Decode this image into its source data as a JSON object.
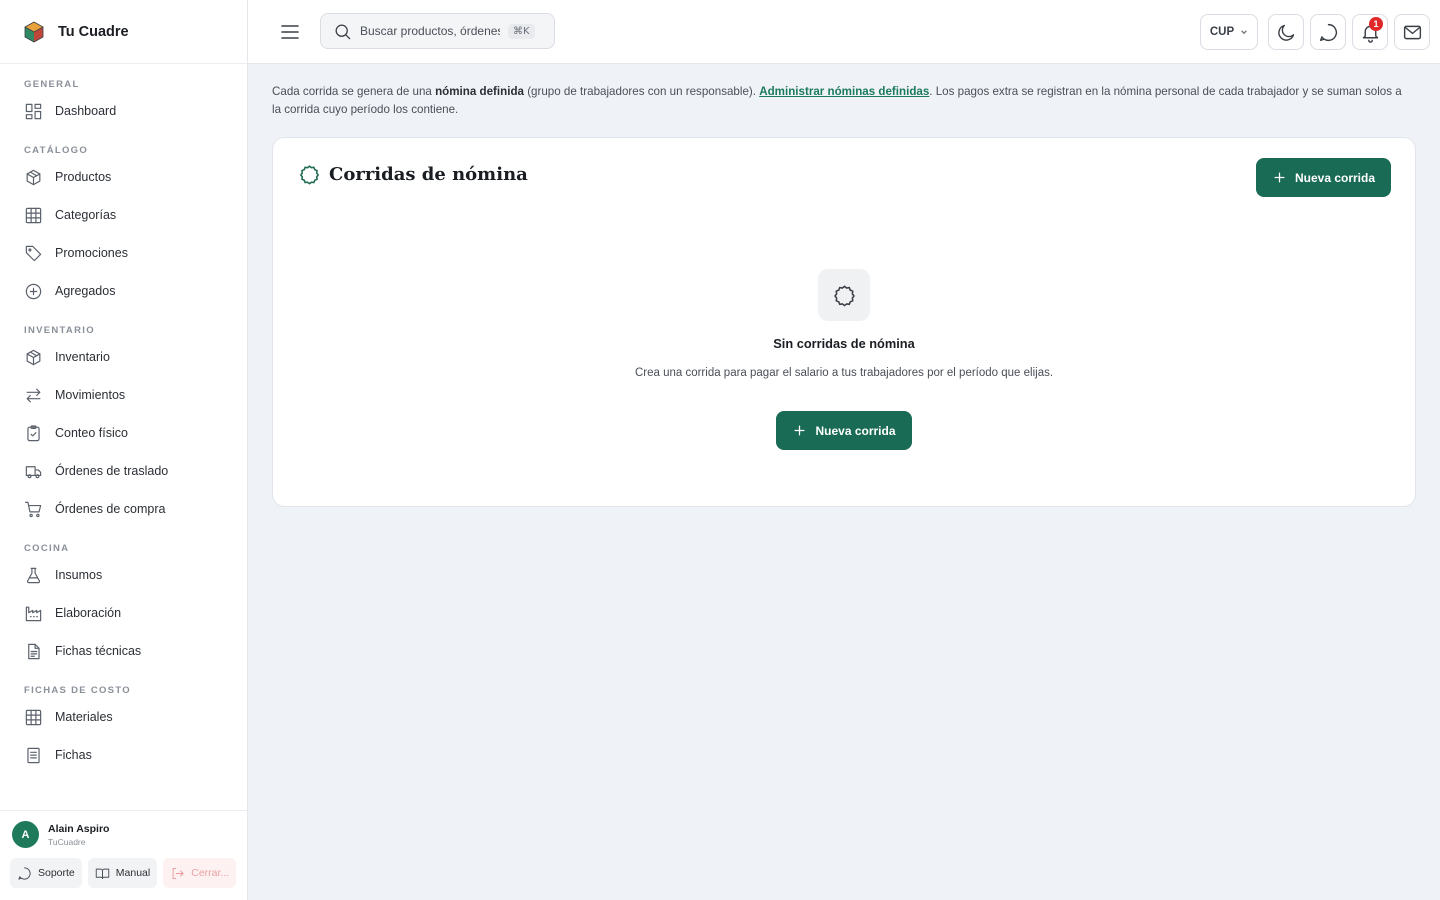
{
  "app": {
    "name": "Tu Cuadre"
  },
  "sidebar": {
    "sections": [
      {
        "title": "GENERAL",
        "items": [
          {
            "label": "Dashboard",
            "icon": "dashboard-icon"
          }
        ]
      },
      {
        "title": "CATÁLOGO",
        "items": [
          {
            "label": "Productos",
            "icon": "box-icon"
          },
          {
            "label": "Categorías",
            "icon": "grid-icon"
          },
          {
            "label": "Promociones",
            "icon": "tag-icon"
          },
          {
            "label": "Agregados",
            "icon": "plus-circle-icon"
          }
        ]
      },
      {
        "title": "INVENTARIO",
        "items": [
          {
            "label": "Inventario",
            "icon": "box-icon"
          },
          {
            "label": "Movimientos",
            "icon": "arrows-icon"
          },
          {
            "label": "Conteo físico",
            "icon": "clipboard-check-icon"
          },
          {
            "label": "Órdenes de traslado",
            "icon": "truck-icon"
          },
          {
            "label": "Órdenes de compra",
            "icon": "cart-icon"
          }
        ]
      },
      {
        "title": "COCINA",
        "items": [
          {
            "label": "Insumos",
            "icon": "flask-icon"
          },
          {
            "label": "Elaboración",
            "icon": "factory-icon"
          },
          {
            "label": "Fichas técnicas",
            "icon": "file-text-icon"
          }
        ]
      },
      {
        "title": "FICHAS DE COSTO",
        "items": [
          {
            "label": "Materiales",
            "icon": "grid-icon"
          },
          {
            "label": "Fichas",
            "icon": "file-text-icon"
          }
        ]
      }
    ],
    "user": {
      "initial": "A",
      "name": "Alain Aspiro",
      "org": "TuCuadre"
    },
    "footer": {
      "support": "Soporte",
      "manual": "Manual",
      "logout": "Cerrar..."
    }
  },
  "header": {
    "search_placeholder": "Buscar productos, órdenes...",
    "shortcut": "⌘K",
    "currency": "CUP",
    "notifications_count": "1"
  },
  "info": {
    "part1": "Cada corrida se genera de una ",
    "bold": "nómina definida",
    "part2": " (grupo de trabajadores con un responsable). ",
    "link": "Administrar nóminas definidas",
    "part3": ". Los pagos extra se registran en la nómina personal de cada trabajador y se suman solos a la corrida cuyo período los contiene."
  },
  "card": {
    "title": "Corridas de nómina",
    "new_button": "Nueva corrida",
    "empty_title": "Sin corridas de nómina",
    "empty_desc": "Crea una corrida para pagar el salario a tus trabajadores por el período que elijas.",
    "empty_button": "Nueva corrida"
  },
  "colors": {
    "accent": "#1a6b55",
    "badge": "#e02929"
  }
}
